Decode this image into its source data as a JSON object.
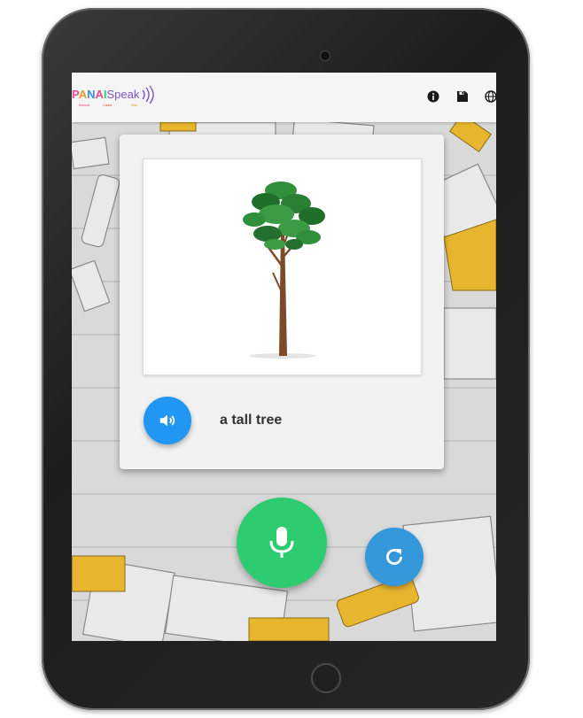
{
  "app": {
    "logo_text": "PANAISpeak",
    "logo_subtitles": [
      "Bemall",
      "Caasi",
      "Rae"
    ]
  },
  "toolbar": {
    "icons": [
      "info-icon",
      "save-icon",
      "globe-icon"
    ]
  },
  "card": {
    "image_subject": "tall-tree-illustration",
    "phrase": "a tall tree",
    "sound_icon": "speaker-icon"
  },
  "controls": {
    "mic_icon": "microphone-icon",
    "refresh_icon": "refresh-icon"
  },
  "colors": {
    "mic_green": "#2ecc71",
    "sound_blue": "#2196f3",
    "refresh_blue": "#3498db",
    "accent_yellow": "#e8b52e"
  }
}
